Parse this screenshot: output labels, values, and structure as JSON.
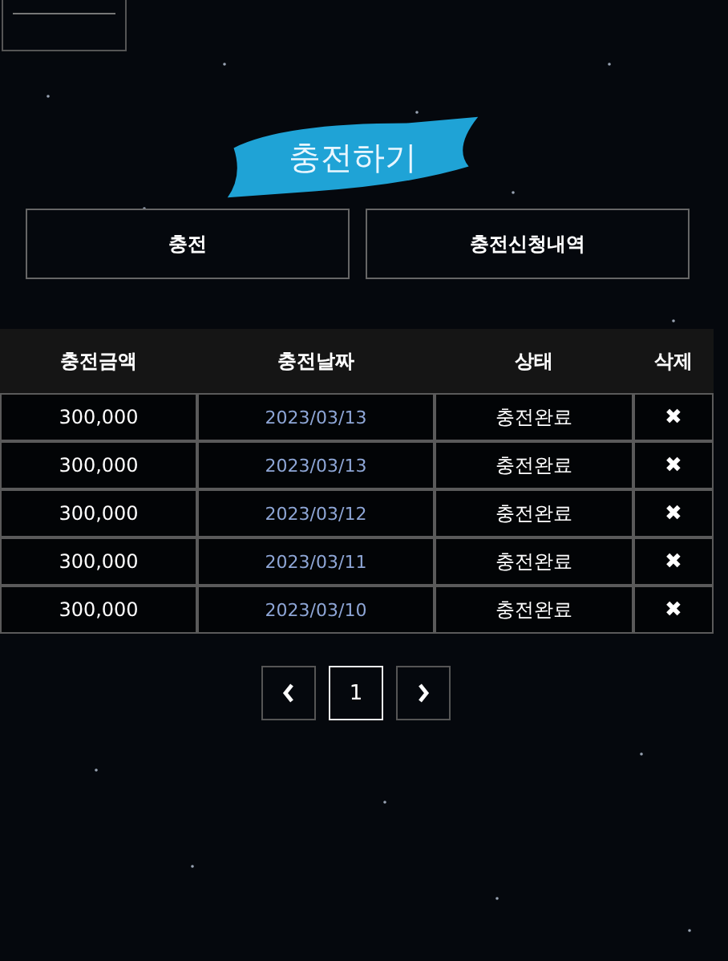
{
  "title": "충전하기",
  "tabs": [
    {
      "label": "충전",
      "selected": false
    },
    {
      "label": "충전신청내역",
      "selected": false
    }
  ],
  "table": {
    "columns": [
      "충전금액",
      "충전날짜",
      "상태",
      "삭제"
    ],
    "rows": [
      {
        "amount": "300,000",
        "date": "2023/03/13",
        "status": "충전완료",
        "delete": "✖"
      },
      {
        "amount": "300,000",
        "date": "2023/03/13",
        "status": "충전완료",
        "delete": "✖"
      },
      {
        "amount": "300,000",
        "date": "2023/03/12",
        "status": "충전완료",
        "delete": "✖"
      },
      {
        "amount": "300,000",
        "date": "2023/03/11",
        "status": "충전완료",
        "delete": "✖"
      },
      {
        "amount": "300,000",
        "date": "2023/03/10",
        "status": "충전완료",
        "delete": "✖"
      }
    ]
  },
  "pagination": {
    "pages": [
      {
        "label": "1",
        "selected": true
      }
    ]
  }
}
